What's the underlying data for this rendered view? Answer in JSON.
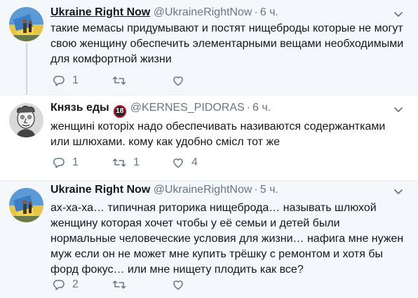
{
  "tweets": [
    {
      "author_name": "Ukraine Right Now",
      "handle": "@UkraineRightNow",
      "separator": "·",
      "time": "6 ч.",
      "text": "такие мемасы придумывают и постят нищеброды которые не могут свою женщину обеспечить элементарными вещами необходимыми для комфортной жизни",
      "replies": "1",
      "retweets": "",
      "likes": ""
    },
    {
      "author_name": "Князь еды",
      "badge": "18",
      "handle": "@KERNES_PIDORAS",
      "separator": "·",
      "time": "6 ч.",
      "text": "женщині которіх надо обеспечивать називаются содержантками или шлюхами. кому как удобно смісл тот же",
      "replies": "1",
      "retweets": "1",
      "likes": "4"
    },
    {
      "author_name": "Ukraine Right Now",
      "handle": "@UkraineRightNow",
      "separator": "·",
      "time": "5 ч.",
      "text": "ах-ха-ха… типичная риторика нищеброда… называть шлюхой женщину которая хочет чтобы у её семьи и детей были нормальные человеческие условия для жизни… нафига мне нужен муж если он не может мне купить трёшку с ремонтом и хотя бы форд фокус… или мне нищету плодить как все?",
      "replies": "2",
      "retweets": "",
      "likes": ""
    }
  ],
  "icons": {
    "reply": "reply-icon",
    "retweet": "retweet-icon",
    "like": "heart-icon",
    "more": "chevron-down-icon"
  },
  "colors": {
    "name": "#14171a",
    "meta": "#657786",
    "thread_line": "#ccd6dd",
    "highlight_bg": "#f5f8fa"
  }
}
